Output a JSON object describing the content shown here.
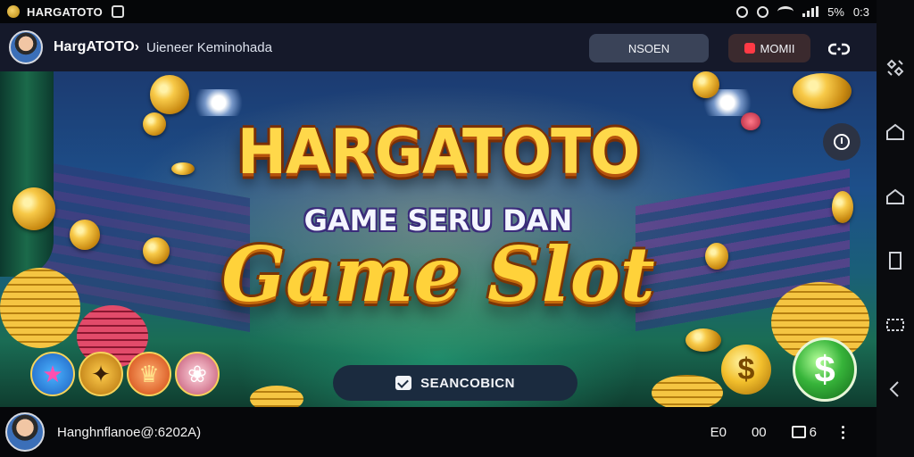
{
  "status_bar": {
    "carrier": "HARGATOTO",
    "battery": "5%",
    "time": "0:3"
  },
  "header": {
    "title": "HargATOTO›",
    "subtitle": "Uieneer Keminohada",
    "button_primary": "NSOEN",
    "button_live": "MOMII"
  },
  "banner": {
    "logo_line1": "HARGATOTO",
    "logo_line2": "GAME SERU DAN",
    "logo_line3": "Game Slot",
    "search_label": "SEANCOBICN",
    "dollar_symbol": "$"
  },
  "footer": {
    "user_label": "Hanghnflanoe@:6202A)",
    "action1": "E0",
    "action2": "00",
    "action3": "6"
  },
  "colors": {
    "header_bg": "#15192a",
    "logo_gold": "#ffd84a",
    "accent_red": "#ff3a45",
    "accent_green": "#37b43a"
  },
  "icons": [
    "sync-icon",
    "alarm-icon",
    "wifi-icon",
    "signal-icon",
    "link-icon",
    "clock-icon",
    "check-icon",
    "grid-icon",
    "home-icon",
    "square-icon",
    "back-icon"
  ]
}
